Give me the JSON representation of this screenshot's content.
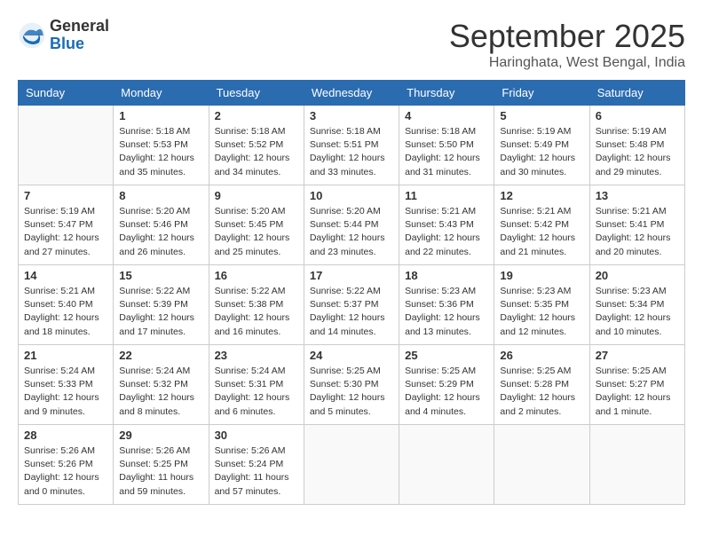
{
  "header": {
    "logo_general": "General",
    "logo_blue": "Blue",
    "month_title": "September 2025",
    "location": "Haringhata, West Bengal, India"
  },
  "days_of_week": [
    "Sunday",
    "Monday",
    "Tuesday",
    "Wednesday",
    "Thursday",
    "Friday",
    "Saturday"
  ],
  "weeks": [
    [
      {
        "day": "",
        "info": ""
      },
      {
        "day": "1",
        "info": "Sunrise: 5:18 AM\nSunset: 5:53 PM\nDaylight: 12 hours\nand 35 minutes."
      },
      {
        "day": "2",
        "info": "Sunrise: 5:18 AM\nSunset: 5:52 PM\nDaylight: 12 hours\nand 34 minutes."
      },
      {
        "day": "3",
        "info": "Sunrise: 5:18 AM\nSunset: 5:51 PM\nDaylight: 12 hours\nand 33 minutes."
      },
      {
        "day": "4",
        "info": "Sunrise: 5:18 AM\nSunset: 5:50 PM\nDaylight: 12 hours\nand 31 minutes."
      },
      {
        "day": "5",
        "info": "Sunrise: 5:19 AM\nSunset: 5:49 PM\nDaylight: 12 hours\nand 30 minutes."
      },
      {
        "day": "6",
        "info": "Sunrise: 5:19 AM\nSunset: 5:48 PM\nDaylight: 12 hours\nand 29 minutes."
      }
    ],
    [
      {
        "day": "7",
        "info": "Sunrise: 5:19 AM\nSunset: 5:47 PM\nDaylight: 12 hours\nand 27 minutes."
      },
      {
        "day": "8",
        "info": "Sunrise: 5:20 AM\nSunset: 5:46 PM\nDaylight: 12 hours\nand 26 minutes."
      },
      {
        "day": "9",
        "info": "Sunrise: 5:20 AM\nSunset: 5:45 PM\nDaylight: 12 hours\nand 25 minutes."
      },
      {
        "day": "10",
        "info": "Sunrise: 5:20 AM\nSunset: 5:44 PM\nDaylight: 12 hours\nand 23 minutes."
      },
      {
        "day": "11",
        "info": "Sunrise: 5:21 AM\nSunset: 5:43 PM\nDaylight: 12 hours\nand 22 minutes."
      },
      {
        "day": "12",
        "info": "Sunrise: 5:21 AM\nSunset: 5:42 PM\nDaylight: 12 hours\nand 21 minutes."
      },
      {
        "day": "13",
        "info": "Sunrise: 5:21 AM\nSunset: 5:41 PM\nDaylight: 12 hours\nand 20 minutes."
      }
    ],
    [
      {
        "day": "14",
        "info": "Sunrise: 5:21 AM\nSunset: 5:40 PM\nDaylight: 12 hours\nand 18 minutes."
      },
      {
        "day": "15",
        "info": "Sunrise: 5:22 AM\nSunset: 5:39 PM\nDaylight: 12 hours\nand 17 minutes."
      },
      {
        "day": "16",
        "info": "Sunrise: 5:22 AM\nSunset: 5:38 PM\nDaylight: 12 hours\nand 16 minutes."
      },
      {
        "day": "17",
        "info": "Sunrise: 5:22 AM\nSunset: 5:37 PM\nDaylight: 12 hours\nand 14 minutes."
      },
      {
        "day": "18",
        "info": "Sunrise: 5:23 AM\nSunset: 5:36 PM\nDaylight: 12 hours\nand 13 minutes."
      },
      {
        "day": "19",
        "info": "Sunrise: 5:23 AM\nSunset: 5:35 PM\nDaylight: 12 hours\nand 12 minutes."
      },
      {
        "day": "20",
        "info": "Sunrise: 5:23 AM\nSunset: 5:34 PM\nDaylight: 12 hours\nand 10 minutes."
      }
    ],
    [
      {
        "day": "21",
        "info": "Sunrise: 5:24 AM\nSunset: 5:33 PM\nDaylight: 12 hours\nand 9 minutes."
      },
      {
        "day": "22",
        "info": "Sunrise: 5:24 AM\nSunset: 5:32 PM\nDaylight: 12 hours\nand 8 minutes."
      },
      {
        "day": "23",
        "info": "Sunrise: 5:24 AM\nSunset: 5:31 PM\nDaylight: 12 hours\nand 6 minutes."
      },
      {
        "day": "24",
        "info": "Sunrise: 5:25 AM\nSunset: 5:30 PM\nDaylight: 12 hours\nand 5 minutes."
      },
      {
        "day": "25",
        "info": "Sunrise: 5:25 AM\nSunset: 5:29 PM\nDaylight: 12 hours\nand 4 minutes."
      },
      {
        "day": "26",
        "info": "Sunrise: 5:25 AM\nSunset: 5:28 PM\nDaylight: 12 hours\nand 2 minutes."
      },
      {
        "day": "27",
        "info": "Sunrise: 5:25 AM\nSunset: 5:27 PM\nDaylight: 12 hours\nand 1 minute."
      }
    ],
    [
      {
        "day": "28",
        "info": "Sunrise: 5:26 AM\nSunset: 5:26 PM\nDaylight: 12 hours\nand 0 minutes."
      },
      {
        "day": "29",
        "info": "Sunrise: 5:26 AM\nSunset: 5:25 PM\nDaylight: 11 hours\nand 59 minutes."
      },
      {
        "day": "30",
        "info": "Sunrise: 5:26 AM\nSunset: 5:24 PM\nDaylight: 11 hours\nand 57 minutes."
      },
      {
        "day": "",
        "info": ""
      },
      {
        "day": "",
        "info": ""
      },
      {
        "day": "",
        "info": ""
      },
      {
        "day": "",
        "info": ""
      }
    ]
  ]
}
